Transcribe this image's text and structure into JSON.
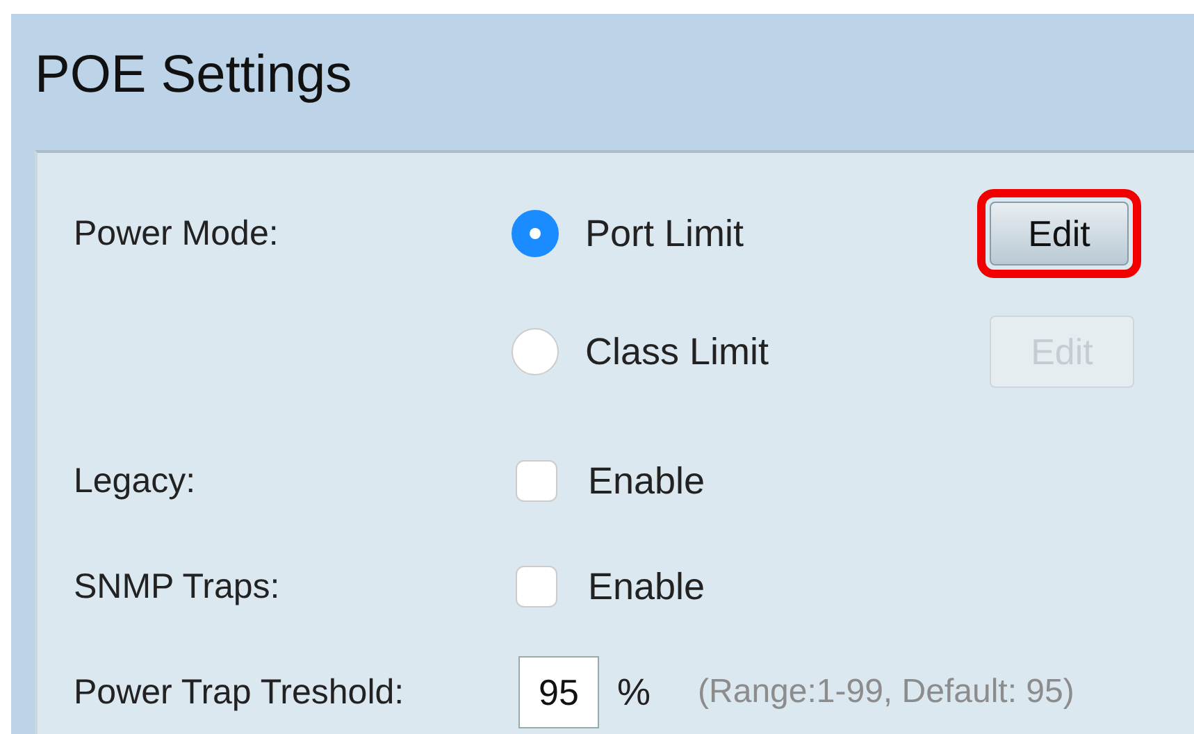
{
  "title": "POE Settings",
  "power_mode": {
    "label": "Power Mode:",
    "options": [
      {
        "label": "Port Limit",
        "selected": true,
        "edit": {
          "label": "Edit",
          "disabled": false,
          "highlighted": true
        }
      },
      {
        "label": "Class Limit",
        "selected": false,
        "edit": {
          "label": "Edit",
          "disabled": true,
          "highlighted": false
        }
      }
    ]
  },
  "checkboxes": [
    {
      "label": "Legacy:",
      "option": "Enable",
      "checked": false
    },
    {
      "label": "SNMP Traps:",
      "option": "Enable",
      "checked": false
    }
  ],
  "threshold": {
    "label": "Power Trap Treshold:",
    "value": "95",
    "unit": "%",
    "hint": "(Range:1-99, Default: 95)"
  }
}
